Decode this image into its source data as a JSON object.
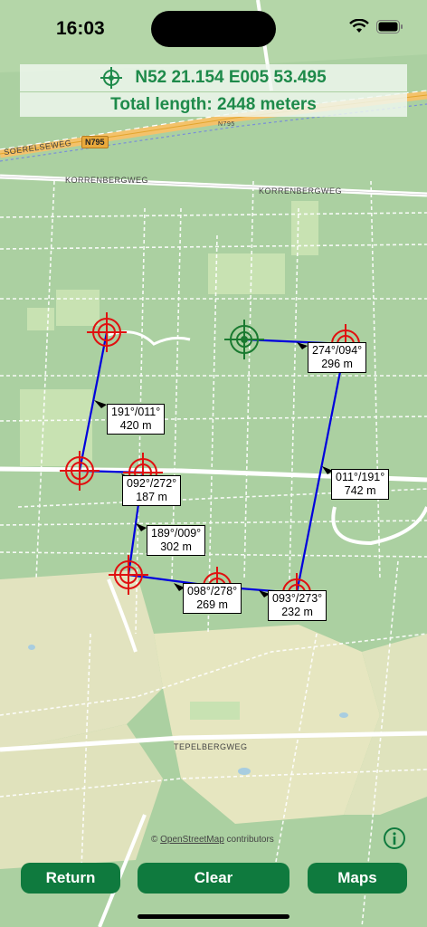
{
  "status_bar": {
    "time": "16:03"
  },
  "header": {
    "coordinates": "N52 21.154 E005 53.495",
    "total_length": "Total length: 2448 meters"
  },
  "map": {
    "road_labels": [
      "SOERELSEWEG",
      "KORRENBERGWEG",
      "KORRENBERGWEG",
      "TEPELBERGWEG",
      "N795",
      "N795"
    ],
    "attribution_prefix": "©",
    "attribution_link": "OpenStreetMap",
    "attribution_suffix": "contributors"
  },
  "segments": [
    {
      "bearing": "191°/011°",
      "distance": "420 m"
    },
    {
      "bearing": "092°/272°",
      "distance": "187 m"
    },
    {
      "bearing": "189°/009°",
      "distance": "302 m"
    },
    {
      "bearing": "098°/278°",
      "distance": "269 m"
    },
    {
      "bearing": "093°/273°",
      "distance": "232 m"
    },
    {
      "bearing": "011°/191°",
      "distance": "742 m"
    },
    {
      "bearing": "274°/094°",
      "distance": "296 m"
    }
  ],
  "buttons": {
    "return_label": "Return",
    "clear_label": "Clear",
    "maps_label": "Maps"
  },
  "colors": {
    "accent": "#0f7a3e",
    "route": "#0000dd",
    "marker": "#e01010",
    "start_marker": "#1a7a30"
  }
}
